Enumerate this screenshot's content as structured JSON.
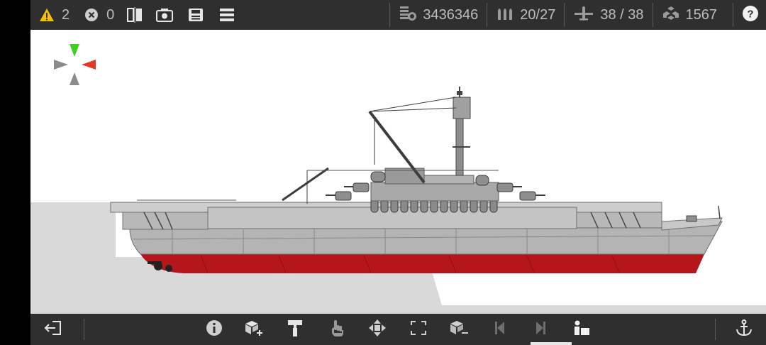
{
  "topbar": {
    "warnings": {
      "icon": "warning-icon",
      "count": "2",
      "color": "#f2c200"
    },
    "errors": {
      "icon": "error-x-icon",
      "count": "0"
    },
    "tools": [
      "mirror-icon",
      "screenshot-icon",
      "save-icon",
      "menu-icon"
    ],
    "stats": [
      {
        "icon": "cost-icon",
        "value": "3436346"
      },
      {
        "icon": "ammo-icon",
        "value": "20/27"
      },
      {
        "icon": "aircraft-icon",
        "value": "38 / 38"
      },
      {
        "icon": "parts-icon",
        "value": "1567"
      }
    ],
    "help_icon": "help-icon"
  },
  "gizmo": {
    "up_color": "#3ecf1f",
    "right_color": "#e23a25",
    "other_color": "#8c8c8c"
  },
  "ship": {
    "hull_color": "#b5161b",
    "superstructure_color": "#a9a9a9"
  },
  "bottombar": {
    "buttons": [
      "exit-icon",
      "info-icon",
      "add-block-icon",
      "paint-icon",
      "select-hand-icon",
      "move-icon",
      "resize-icon",
      "remove-block-icon",
      "step-back-icon",
      "step-forward-icon",
      "load-cargo-icon",
      "anchor-icon"
    ],
    "active": "load-cargo-icon"
  }
}
